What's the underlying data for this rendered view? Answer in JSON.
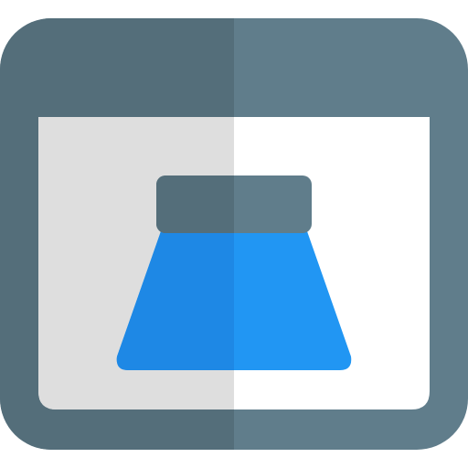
{
  "icon": {
    "name": "browser-window-with-flask-icon",
    "colors": {
      "frame_shaded": "#546E7A",
      "frame_light": "#607D8B",
      "content_shaded": "#DEDEDE",
      "content_light": "#FFFFFF",
      "flask_shaded": "#1E88E5",
      "flask_light": "#2196F3",
      "flask_cap_shaded": "#546E7A",
      "flask_cap_light": "#607D8B"
    }
  }
}
